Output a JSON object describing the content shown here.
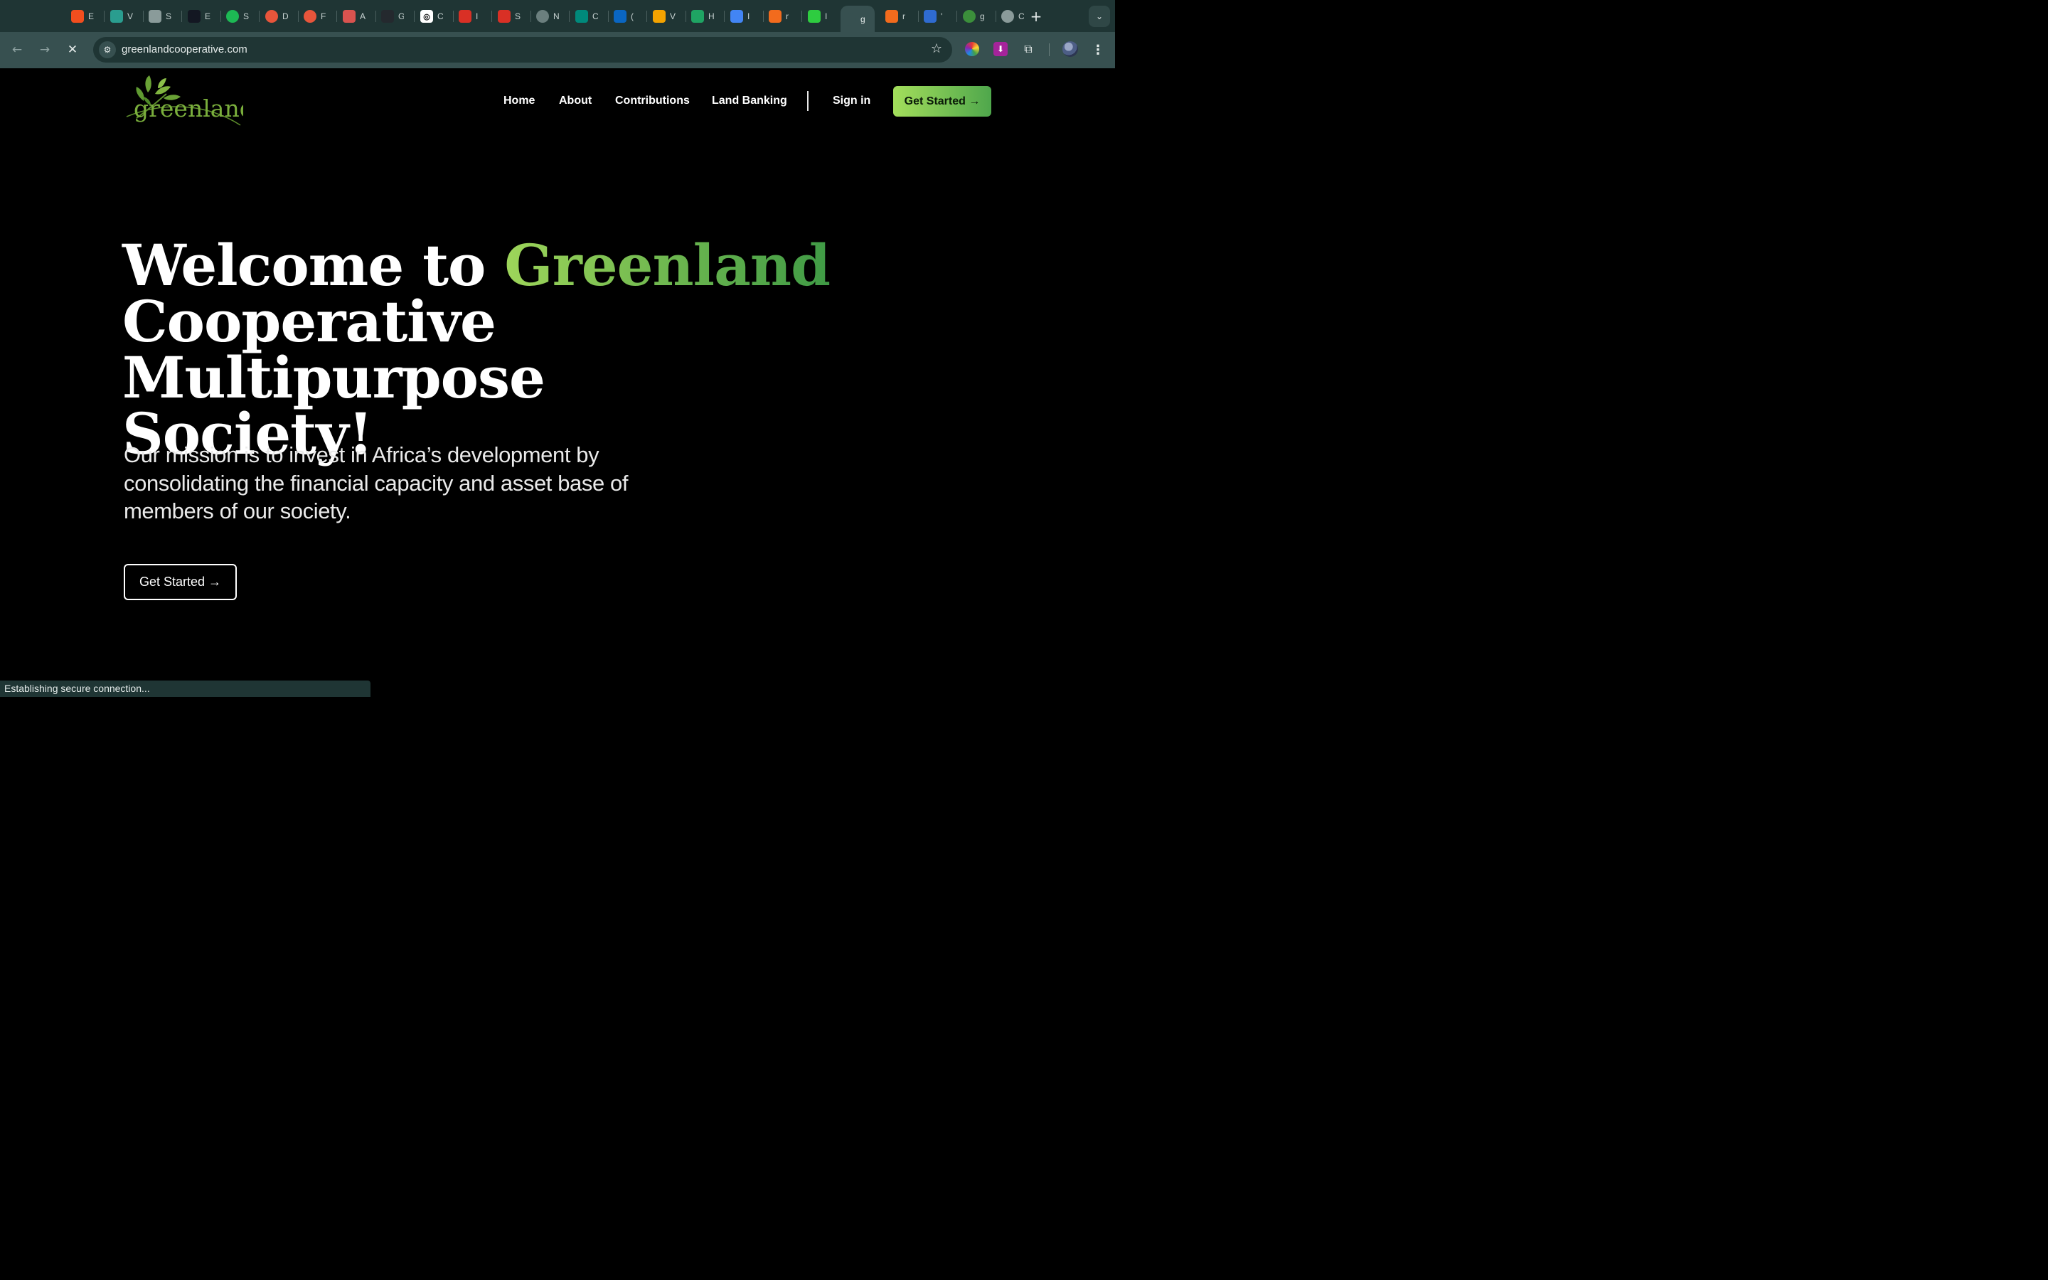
{
  "browser": {
    "tabs": [
      {
        "icon": "figma-icon",
        "letter": "E",
        "color": "#f24e1e"
      },
      {
        "icon": "vuetify-icon",
        "letter": "V",
        "color": "#2a9d8f"
      },
      {
        "icon": "camera-icon",
        "letter": "S",
        "color": "#8a9b9a"
      },
      {
        "icon": "tradingview-icon",
        "letter": "E",
        "color": "#131722"
      },
      {
        "icon": "spotify-icon",
        "letter": "S",
        "color": "#1db954"
      },
      {
        "icon": "target-icon",
        "letter": "D",
        "color": "#e8553b"
      },
      {
        "icon": "target-icon",
        "letter": "F",
        "color": "#e8553b"
      },
      {
        "icon": "cube-icon",
        "letter": "A",
        "color": "#d9534f"
      },
      {
        "icon": "github-icon",
        "letter": "G",
        "color": "#24292e"
      },
      {
        "icon": "openai-icon",
        "letter": "C",
        "color": "#ffffff"
      },
      {
        "icon": "gmail-icon",
        "letter": "I",
        "color": "#d93025"
      },
      {
        "icon": "gmail-icon",
        "letter": "S",
        "color": "#d93025"
      },
      {
        "icon": "chrome-icon",
        "letter": "N",
        "color": "#6b7f7e"
      },
      {
        "icon": "meet-icon",
        "letter": "C",
        "color": "#00897b"
      },
      {
        "icon": "linkedin-icon",
        "letter": "(",
        "color": "#0a66c2"
      },
      {
        "icon": "chat-icon",
        "letter": "V",
        "color": "#f4a300"
      },
      {
        "icon": "drive-icon",
        "letter": "H",
        "color": "#1fa463"
      },
      {
        "icon": "docs-icon",
        "letter": "I",
        "color": "#4285f4"
      },
      {
        "icon": "vite-icon",
        "letter": "r",
        "color": "#f26b1d"
      },
      {
        "icon": "asterisk-icon",
        "letter": "I",
        "color": "#2ecc40"
      },
      {
        "icon": "greenland-icon",
        "letter": "g",
        "color": "#375050",
        "active": true
      },
      {
        "icon": "vite-icon",
        "letter": "r",
        "color": "#f26b1d"
      },
      {
        "icon": "shield-icon",
        "letter": "'",
        "color": "#2f6bd0"
      },
      {
        "icon": "greenland-icon",
        "letter": "g",
        "color": "#3b8f3b"
      },
      {
        "icon": "globe-icon",
        "letter": "C",
        "color": "#8a9b9a"
      }
    ],
    "new_tab": "+",
    "tab_menu": "⌄",
    "close": "×",
    "url": "greenlandcooperative.com",
    "status": "Establishing secure connection..."
  },
  "site": {
    "logo_text": "greenland",
    "nav": [
      "Home",
      "About",
      "Contributions",
      "Land Banking"
    ],
    "sign_in": "Sign in",
    "get_started_top": "Get Started →",
    "hero": {
      "title_pre": "Welcome to ",
      "title_accent": "Greenland",
      "title_line2": "Cooperative Multipurpose",
      "title_line3": "Society!"
    },
    "mission": "Our mission is to invest in Africa’s development by consolidating the financial capacity and asset base of members of our society.",
    "get_started_hero": "Get Started →"
  }
}
